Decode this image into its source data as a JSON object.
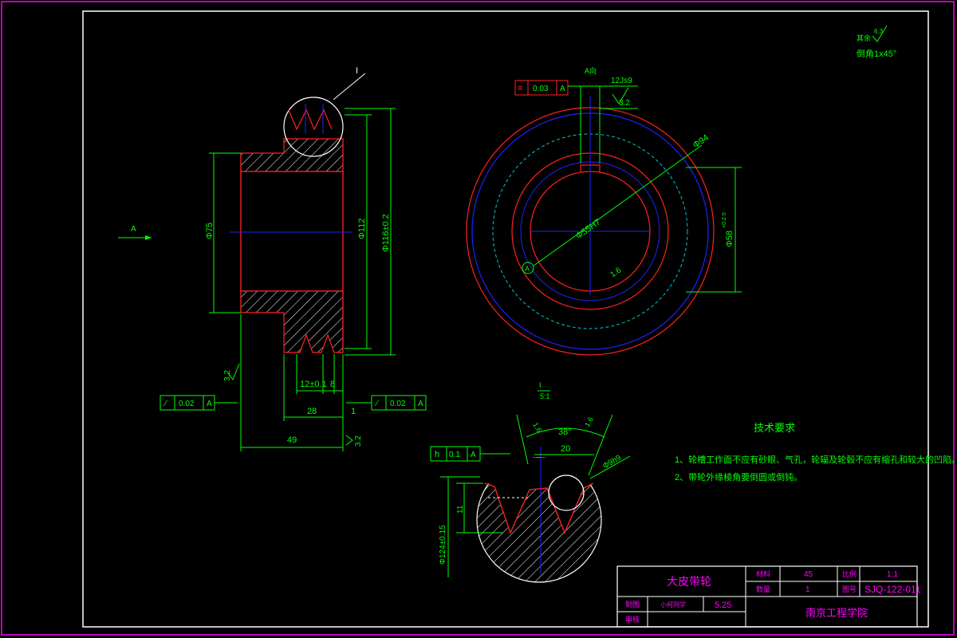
{
  "colors": {
    "background": "#000000",
    "frame": "#ff00ff",
    "outline": "#ff2020",
    "dimension": "#00ff00",
    "centerline": "#2020ff",
    "hatch": "#ffffff",
    "hidden": "#00c8c8",
    "text": "#00ff00",
    "title_text": "#ff00ff"
  },
  "surface_note": {
    "label": "其余",
    "roughness": "6.3",
    "chamfer": "倒角1x45°"
  },
  "section_view": {
    "view_arrow": "A",
    "detail_tag": "I",
    "dia_bore": "Φ75",
    "dia_groove": "Φ112",
    "dia_outer": "Φ116±0.2",
    "groove_pitch": "12±0.1",
    "groove_edge": "8",
    "hub_width": "28",
    "total_width": "49",
    "rough_left": "3.2",
    "rough_bottom": "3.2",
    "tolerance_left": {
      "symbol": "⁄",
      "value": "0.02",
      "datum": "A"
    },
    "tolerance_right": {
      "symbol": "⁄",
      "value": "0.02",
      "datum": "A"
    },
    "datum_gap": "1"
  },
  "end_view": {
    "view_label": "A向",
    "tolerance": {
      "symbol": "≡",
      "value": "0.03",
      "datum": "A"
    },
    "key_width": "12Js9",
    "rough_key": "3.2",
    "dia_outer": "Φ94",
    "dia_bore": "Φ55H7",
    "dia_keyway": "Φ58",
    "keyway_tol": "+0.2 0",
    "rough_bore": "1.6",
    "datum": "A"
  },
  "detail_view": {
    "tag": "I",
    "scale": "5:1",
    "angle": "38°",
    "width_20": "20",
    "dia_9": "Φ9h9",
    "rough_1": "1.6",
    "rough_2": "1.6",
    "depth_11": "11",
    "dia_124": "Φ124±0.15",
    "tolerance": {
      "symbol": "h",
      "value": "0.1",
      "datum": "A"
    }
  },
  "tech_requirements": {
    "title": "技术要求",
    "items": [
      "1、轮槽工作面不应有砂眼、气孔，轮辐及轮毂不应有缩孔和较大的凹陷。",
      "2、带轮外缘棱角要倒圆或倒钝。"
    ]
  },
  "title_block": {
    "part_name": "大皮带轮",
    "material_label": "材料",
    "material": "45",
    "scale_label": "比例",
    "scale": "1:1",
    "qty_label": "数量",
    "qty": "1",
    "drawing_no_label": "图号",
    "drawing_no": "SJQ-122-011",
    "designer_label": "制图",
    "designer": "小柯同学",
    "date": "5.25",
    "checker_label": "审核",
    "school": "南京工程学院"
  }
}
